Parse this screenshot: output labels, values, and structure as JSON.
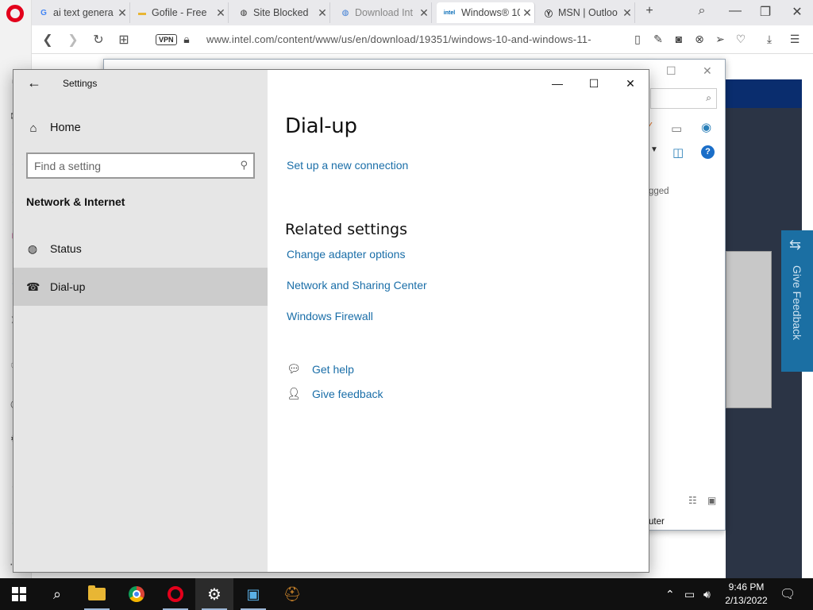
{
  "browser": {
    "tabs": [
      {
        "title": "ai text genera",
        "favicon": "G"
      },
      {
        "title": "Gofile - Free",
        "favicon": "folder"
      },
      {
        "title": "Site Blocked",
        "favicon": "globe"
      },
      {
        "title": "Download Int",
        "favicon": "globe"
      },
      {
        "title": "Windows® 10",
        "favicon": "intel"
      },
      {
        "title": "MSN | Outloo",
        "favicon": "msn"
      }
    ],
    "vpn_label": "VPN",
    "url": "www.intel.com/content/www/us/en/download/19351/windows-10-and-windows-11-"
  },
  "background_page": {
    "text_fragment_1": "gged",
    "text_fragment_2": "uter",
    "give_feedback_label": "Give Feedback"
  },
  "settings": {
    "app_title": "Settings",
    "home_label": "Home",
    "search_placeholder": "Find a setting",
    "section_heading": "Network & Internet",
    "nav_items": [
      {
        "label": "Status",
        "icon": "globe-icon"
      },
      {
        "label": "Dial-up",
        "icon": "dialup-icon"
      }
    ],
    "page_title": "Dial-up",
    "setup_link": "Set up a new connection",
    "related_heading": "Related settings",
    "related_links": [
      "Change adapter options",
      "Network and Sharing Center",
      "Windows Firewall"
    ],
    "help_link": "Get help",
    "feedback_link": "Give feedback"
  },
  "taskbar": {
    "time": "9:46 PM",
    "date": "2/13/2022"
  },
  "colors": {
    "link": "#1a6ea8",
    "sidebar_bg": "#e6e6e6",
    "selected_bg": "#cccccc",
    "taskbar_bg": "#101010"
  }
}
